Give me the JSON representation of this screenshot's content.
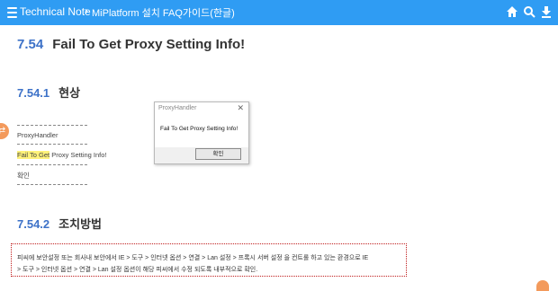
{
  "header": {
    "app_title": "Technical Note",
    "breadcrumb_separator": "›",
    "breadcrumb": "MiPlatform 설치 FAQ가이드(한글)",
    "icons": [
      "menu-icon",
      "home-icon",
      "search-icon",
      "download-icon"
    ]
  },
  "section": {
    "number": "7.54",
    "title": "Fail To Get Proxy Setting Info!"
  },
  "subsection1": {
    "number": "7.54.1",
    "title": "현상"
  },
  "message_block": {
    "line1": "ProxyHandler",
    "line2_highlight": "Fail To Get",
    "line2_rest": " Proxy Setting Info!",
    "line3": "확인"
  },
  "dialog": {
    "title": "ProxyHandler",
    "close": "✕",
    "message": "Fail To Get Proxy Setting Info!",
    "ok_button": "확인"
  },
  "subsection2": {
    "number": "7.54.2",
    "title": "조치방법"
  },
  "notice": {
    "line1": "피씨에 보안설정 또는 회사내 보안에서 IE > 도구 > 인터넷 옵션 > 연결 > Lan 설정 > 프록시 서버 설정 을 컨트롤 하고 있는 환경으로 IE",
    "line2": "> 도구 > 인터넷 옵션 > 연결 > Lan 설정 옵션이 해당 피씨에서 수정 되도록 내부적으로 확인."
  },
  "colors": {
    "topbar": "#2f9cf3",
    "heading_number": "#3d72c8",
    "highlight": "#fff27a",
    "notice_border": "#c01e1e",
    "side_tab": "#f39a5c"
  }
}
